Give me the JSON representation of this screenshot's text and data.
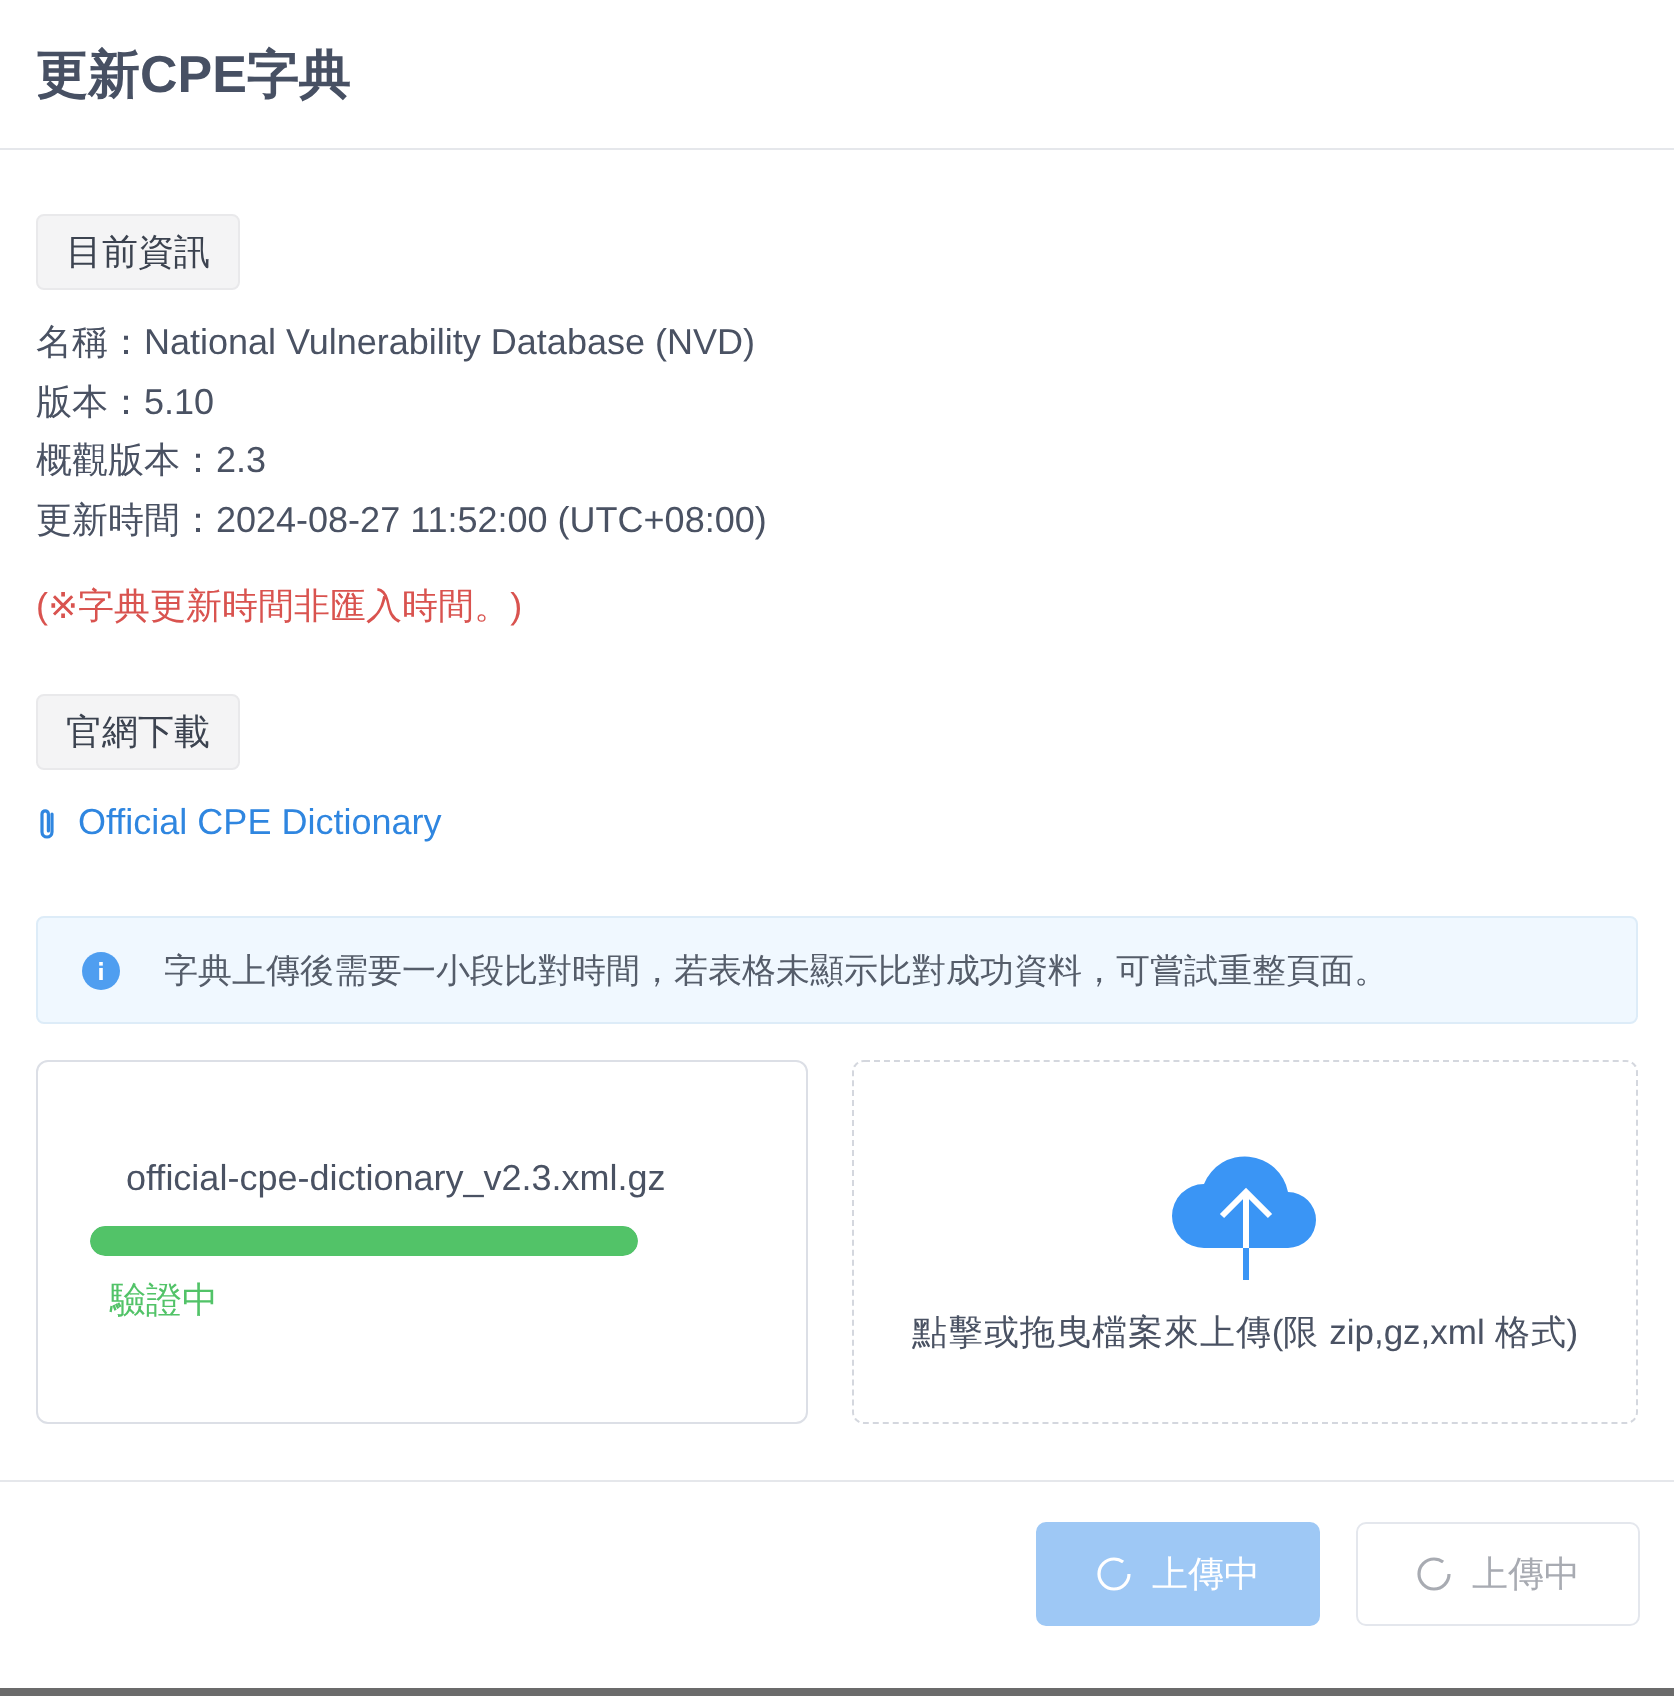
{
  "dialog": {
    "title": "更新CPE字典"
  },
  "current_info": {
    "tag": "目前資訊",
    "fields": [
      {
        "label": "名稱",
        "separator": "：",
        "value": "National Vulnerability Database (NVD)"
      },
      {
        "label": "版本",
        "separator": "：",
        "value": "5.10"
      },
      {
        "label": "概觀版本",
        "separator": "：",
        "value": "2.3"
      },
      {
        "label": "更新時間",
        "separator": "：",
        "value": "2024-08-27 11:52:00 (UTC+08:00)"
      }
    ],
    "note": "(※字典更新時間非匯入時間。)"
  },
  "download": {
    "tag": "官網下載",
    "link": "Official CPE Dictionary"
  },
  "alert": {
    "text": "字典上傳後需要一小段比對時間，若表格未顯示比對成功資料，可嘗試重整頁面。"
  },
  "upload_file": {
    "name": "official-cpe-dictionary_v2.3.xml.gz",
    "level": 1,
    "status": "驗證中"
  },
  "dropzone": {
    "text": "點擊或拖曳檔案來上傳(限 zip,gz,xml 格式)"
  },
  "buttons": [
    {
      "label": "上傳中",
      "kind": "primary",
      "loading": true,
      "disabled": true
    },
    {
      "label": "上傳中",
      "kind": "default",
      "loading": true,
      "disabled": true
    }
  ]
}
